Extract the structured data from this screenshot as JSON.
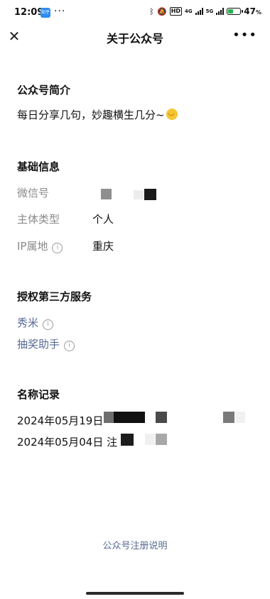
{
  "status_bar": {
    "time": "12:09",
    "app_badge": "知乎",
    "dots": "···",
    "hd": "HD",
    "net1": "4G",
    "net2": "5G",
    "battery_percent": 47,
    "battery_text": "47",
    "battery_unit": "%"
  },
  "nav": {
    "close_glyph": "✕",
    "title": "关于公众号",
    "more_glyph": "•••"
  },
  "intro": {
    "title": "公众号简介",
    "text": "每日分享几句，妙趣横生几分~"
  },
  "basic_info": {
    "title": "基础信息",
    "wechat_id_label": "微信号",
    "entity_type_label": "主体类型",
    "entity_type_value": "个人",
    "ip_label": "IP属地",
    "ip_value": "重庆"
  },
  "authorized": {
    "title": "授权第三方服务",
    "items": [
      "秀米",
      "抽奖助手"
    ]
  },
  "name_records": {
    "title": "名称记录",
    "records": [
      {
        "date": "2024年05月19日"
      },
      {
        "date": "2024年05月04日",
        "suffix": "注"
      }
    ]
  },
  "footer": {
    "link": "公众号注册说明"
  },
  "colors": {
    "link": "#576b95",
    "label_gray": "#8a8a8a",
    "battery_green": "#2bb24c"
  },
  "icons": [
    "close-icon",
    "more-icon",
    "info-icon",
    "smile-emoji-icon",
    "bluetooth-icon",
    "mute-icon",
    "battery-icon"
  ]
}
